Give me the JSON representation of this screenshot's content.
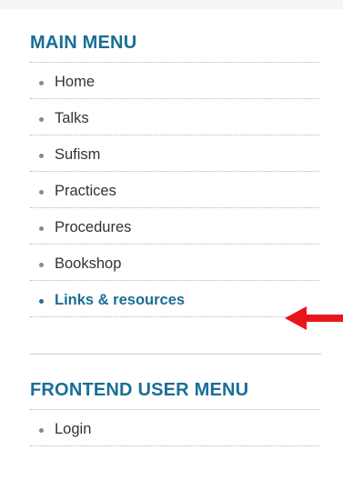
{
  "main_menu": {
    "title": "MAIN MENU",
    "items": [
      {
        "label": "Home"
      },
      {
        "label": "Talks"
      },
      {
        "label": "Sufism"
      },
      {
        "label": "Practices"
      },
      {
        "label": "Procedures"
      },
      {
        "label": "Bookshop"
      },
      {
        "label": "Links & resources",
        "active": true
      }
    ]
  },
  "user_menu": {
    "title": "FRONTEND USER MENU",
    "items": [
      {
        "label": "Login"
      }
    ]
  },
  "annotation": {
    "icon": "left-arrow-icon",
    "color": "#e8161b"
  },
  "colors": {
    "heading": "#1a6e95",
    "active_link": "#1a6e95",
    "link": "#333333"
  }
}
